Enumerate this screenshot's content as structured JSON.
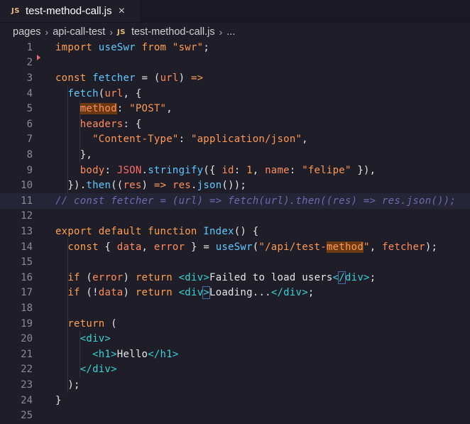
{
  "tab": {
    "icon": "JS",
    "label": "test-method-call.js",
    "close": "×"
  },
  "breadcrumb": {
    "items": [
      "pages",
      "api-call-test",
      "test-method-call.js",
      "..."
    ],
    "sep": "›",
    "icon": "JS"
  },
  "editor": {
    "line_numbers": [
      "1",
      "2",
      "3",
      "4",
      "5",
      "6",
      "7",
      "8",
      "9",
      "10",
      "11",
      "12",
      "13",
      "14",
      "15",
      "16",
      "17",
      "18",
      "19",
      "20",
      "21",
      "22",
      "23",
      "24",
      "25"
    ],
    "current_line": 11,
    "tokens": [
      [
        [
          "kw",
          "import "
        ],
        [
          "fn",
          "useSwr"
        ],
        [
          "kw",
          " from "
        ],
        [
          "str",
          "\"swr\""
        ],
        [
          "id",
          ";"
        ]
      ],
      [],
      [
        [
          "kw",
          "const "
        ],
        [
          "fn",
          "fetcher"
        ],
        [
          "id",
          " = "
        ],
        [
          "id",
          "("
        ],
        [
          "prop",
          "url"
        ],
        [
          "id",
          ") "
        ],
        [
          "kw",
          "=>"
        ]
      ],
      [
        [
          "id",
          "  "
        ],
        [
          "fn",
          "fetch"
        ],
        [
          "id",
          "("
        ],
        [
          "prop",
          "url"
        ],
        [
          "id",
          ", {"
        ]
      ],
      [
        [
          "id",
          "    "
        ],
        [
          "prop hl",
          "method"
        ],
        [
          "id",
          ": "
        ],
        [
          "str",
          "\"POST\""
        ],
        [
          "id",
          ","
        ]
      ],
      [
        [
          "id",
          "    "
        ],
        [
          "prop",
          "headers"
        ],
        [
          "id",
          ": {"
        ]
      ],
      [
        [
          "id",
          "      "
        ],
        [
          "str",
          "\"Content-Type\""
        ],
        [
          "id",
          ": "
        ],
        [
          "str",
          "\"application/json\""
        ],
        [
          "id",
          ","
        ]
      ],
      [
        [
          "id",
          "    },"
        ]
      ],
      [
        [
          "id",
          "    "
        ],
        [
          "prop",
          "body"
        ],
        [
          "id",
          ": "
        ],
        [
          "json",
          "JSON"
        ],
        [
          "id",
          "."
        ],
        [
          "fn",
          "stringify"
        ],
        [
          "id",
          "({ "
        ],
        [
          "prop",
          "id"
        ],
        [
          "id",
          ": "
        ],
        [
          "num",
          "1"
        ],
        [
          "id",
          ", "
        ],
        [
          "prop",
          "name"
        ],
        [
          "id",
          ": "
        ],
        [
          "str",
          "\"felipe\""
        ],
        [
          "id",
          " }),"
        ]
      ],
      [
        [
          "id",
          "  })."
        ],
        [
          "fn",
          "then"
        ],
        [
          "id",
          "(("
        ],
        [
          "prop",
          "res"
        ],
        [
          "id",
          ") "
        ],
        [
          "kw",
          "=>"
        ],
        [
          "id",
          " "
        ],
        [
          "prop",
          "res"
        ],
        [
          "id",
          "."
        ],
        [
          "fn",
          "json"
        ],
        [
          "id",
          "());"
        ]
      ],
      [
        [
          "cmt",
          "// const fetcher = (url) => fetch(url).then((res) => res.json());"
        ]
      ],
      [],
      [
        [
          "kw",
          "export default function "
        ],
        [
          "fn",
          "Index"
        ],
        [
          "id",
          "() {"
        ]
      ],
      [
        [
          "id",
          "  "
        ],
        [
          "kw",
          "const "
        ],
        [
          "id",
          "{ "
        ],
        [
          "prop",
          "data"
        ],
        [
          "id",
          ", "
        ],
        [
          "prop",
          "error"
        ],
        [
          "id",
          " } = "
        ],
        [
          "fn",
          "useSwr"
        ],
        [
          "id",
          "("
        ],
        [
          "str",
          "\"/api/test-"
        ],
        [
          "str hl",
          "method"
        ],
        [
          "str",
          "\""
        ],
        [
          "id",
          ", "
        ],
        [
          "prop",
          "fetcher"
        ],
        [
          "id",
          ");"
        ]
      ],
      [],
      [
        [
          "id",
          "  "
        ],
        [
          "kw",
          "if "
        ],
        [
          "id",
          "("
        ],
        [
          "prop",
          "error"
        ],
        [
          "id",
          ") "
        ],
        [
          "kw",
          "return "
        ],
        [
          "tag",
          "<div>"
        ],
        [
          "txt",
          "Failed to load users"
        ],
        [
          "tag",
          "<"
        ],
        [
          "tag bracket-box",
          "/"
        ],
        [
          "tag",
          "div>"
        ],
        [
          "id",
          ";"
        ]
      ],
      [
        [
          "id",
          "  "
        ],
        [
          "kw",
          "if "
        ],
        [
          "id",
          "(!"
        ],
        [
          "prop",
          "data"
        ],
        [
          "id",
          ") "
        ],
        [
          "kw",
          "return "
        ],
        [
          "tag",
          "<div"
        ],
        [
          "tag bracket-box",
          ">"
        ],
        [
          "txt",
          "Loading..."
        ],
        [
          "tag",
          "</div>"
        ],
        [
          "id",
          ";"
        ]
      ],
      [],
      [
        [
          "id",
          "  "
        ],
        [
          "kw",
          "return "
        ],
        [
          "id",
          "("
        ]
      ],
      [
        [
          "id",
          "    "
        ],
        [
          "tag",
          "<div>"
        ]
      ],
      [
        [
          "id",
          "      "
        ],
        [
          "tag",
          "<h1>"
        ],
        [
          "txt",
          "Hello"
        ],
        [
          "tag",
          "</h1>"
        ]
      ],
      [
        [
          "id",
          "    "
        ],
        [
          "tag",
          "</div>"
        ]
      ],
      [
        [
          "id",
          "  );"
        ]
      ],
      [
        [
          "id",
          "}"
        ]
      ],
      []
    ]
  },
  "colors": {
    "background": "#1e1d28",
    "keyword": "#ffa14f",
    "function": "#5fc9ff",
    "string": "#ff9a55",
    "tag": "#38d3d6",
    "comment": "#6e6ab0"
  }
}
